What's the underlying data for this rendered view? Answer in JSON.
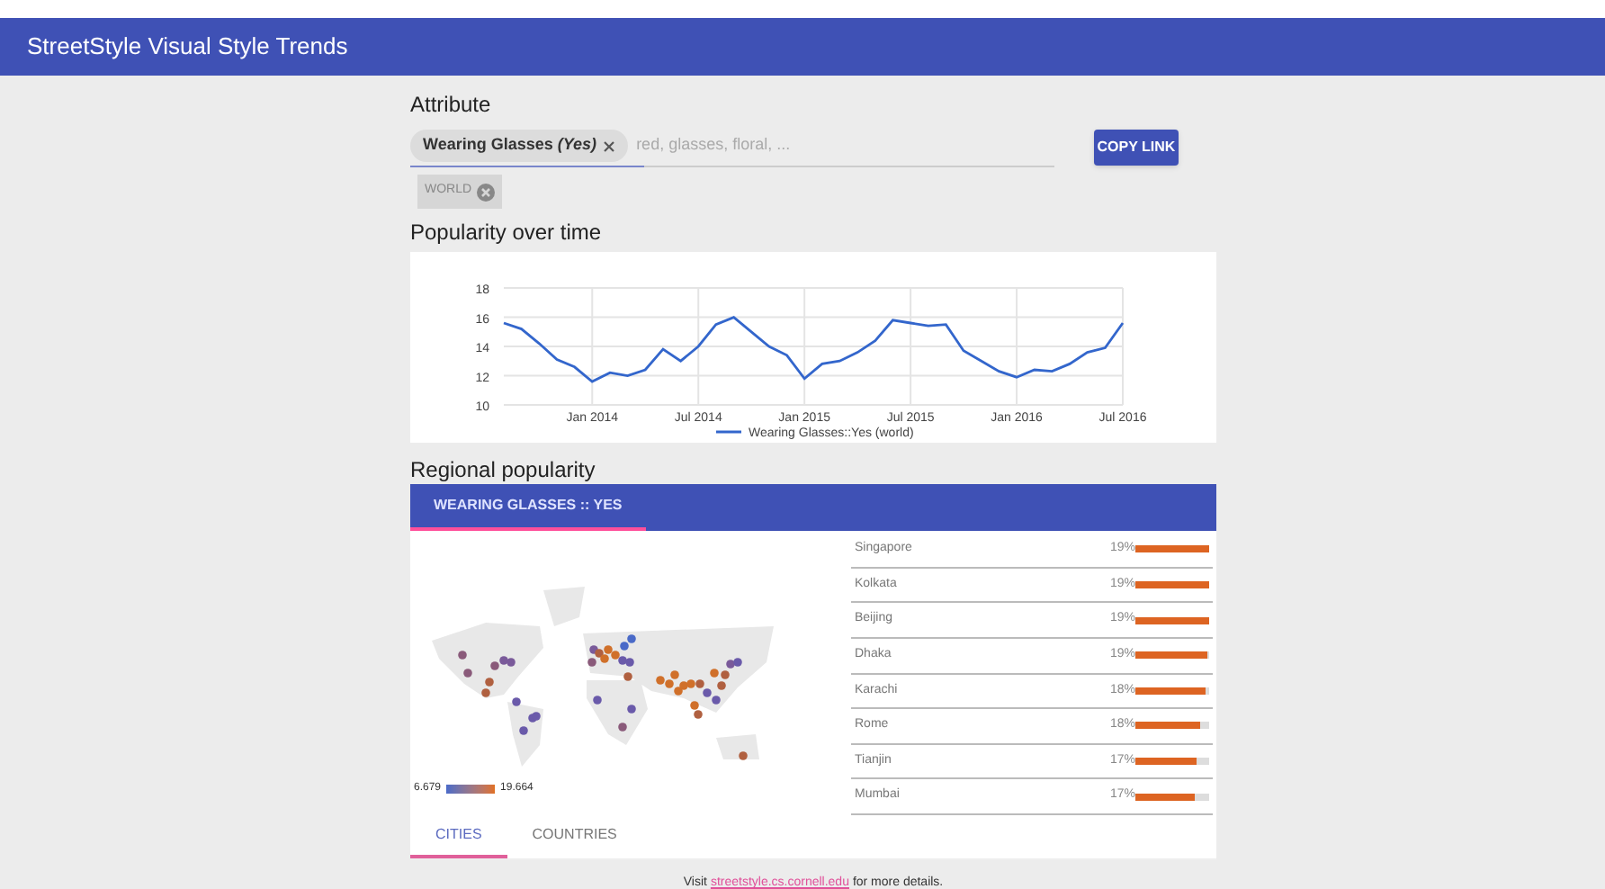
{
  "app_bar": {
    "title": "StreetStyle Visual Style Trends"
  },
  "attribute": {
    "heading": "Attribute",
    "chip": "Wearing Glasses *(Yes)*",
    "placeholder": "red, glasses, floral, ...",
    "region_chip": "WORLD",
    "copy_button": "COPY LINK"
  },
  "popularity": {
    "heading": "Popularity over time",
    "chart_data": {
      "type": "line",
      "categories": [
        null,
        null,
        null,
        null,
        null,
        "Jan 2014",
        null,
        null,
        null,
        null,
        null,
        "Jul 2014",
        null,
        null,
        null,
        null,
        null,
        "Jan 2015",
        null,
        null,
        null,
        null,
        null,
        "Jul 2015",
        null,
        null,
        null,
        null,
        null,
        "Jan 2016",
        null,
        null,
        null,
        null,
        null,
        "Jul 2016"
      ],
      "series": [
        {
          "name": "Wearing Glasses::Yes (world)",
          "color": "#3366cc",
          "values": [
            15.6,
            15.2,
            14.2,
            13.1,
            12.6,
            11.6,
            12.2,
            12.0,
            12.4,
            13.8,
            13.0,
            14.0,
            15.5,
            16.0,
            15.0,
            14.0,
            13.4,
            11.8,
            12.8,
            13.0,
            13.6,
            14.4,
            15.8,
            15.6,
            15.4,
            15.5,
            13.7,
            13.0,
            12.3,
            11.9,
            12.4,
            12.3,
            12.8,
            13.6,
            13.9,
            15.6
          ]
        }
      ],
      "ylim": [
        10,
        18
      ],
      "yticks": [
        10,
        12,
        14,
        16,
        18
      ],
      "grid": true
    }
  },
  "regional": {
    "heading": "Regional popularity",
    "tabs": [
      {
        "label": "WEARING GLASSES :: YES",
        "selected": true
      }
    ],
    "legend_min": "6.679",
    "legend_max": "19.664",
    "cities": [
      {
        "name": "Singapore",
        "percent": "19%",
        "level": 1
      },
      {
        "name": "Kolkata",
        "percent": "19%",
        "level": 0.99
      },
      {
        "name": "Beijing",
        "percent": "19%",
        "level": 0.99
      },
      {
        "name": "Dhaka",
        "percent": "19%",
        "level": 0.97
      },
      {
        "name": "Karachi",
        "percent": "18%",
        "level": 0.94
      },
      {
        "name": "Rome",
        "percent": "18%",
        "level": 0.87
      },
      {
        "name": "Tianjin",
        "percent": "17%",
        "level": 0.82
      },
      {
        "name": "Mumbai",
        "percent": "17%",
        "level": 0.8
      }
    ],
    "view_tabs": [
      {
        "label": "CITIES",
        "selected": true
      },
      {
        "label": "COUNTRIES",
        "selected": false
      }
    ]
  },
  "footer": {
    "before": "Visit",
    "link": "streetstyle.cs.cornell.edu",
    "after": "for more details."
  }
}
